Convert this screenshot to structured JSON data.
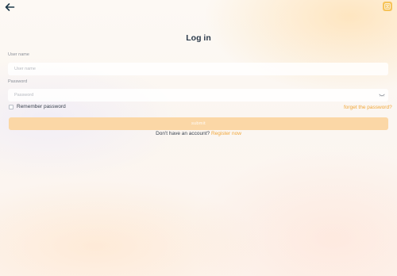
{
  "header": {
    "back_icon": "arrow-left-icon",
    "language_icon": "translate-icon",
    "accent_color": "#f6c35a"
  },
  "page": {
    "title": "Log in"
  },
  "form": {
    "username": {
      "label": "User name",
      "placeholder": "User name",
      "value": ""
    },
    "password": {
      "label": "Password",
      "placeholder": "Password",
      "value": "",
      "toggle_icon": "eye-closed-icon"
    },
    "remember": {
      "label": "Remember password",
      "checked": false
    },
    "forgot_label": "forget the password?",
    "submit_label": "submit"
  },
  "footer": {
    "no_account_text": "Don't have an account?",
    "register_label": "Register now"
  },
  "colors": {
    "title_text": "#2b3a4a",
    "link": "#f0a63a",
    "submit_button": "#fbd7a6"
  }
}
